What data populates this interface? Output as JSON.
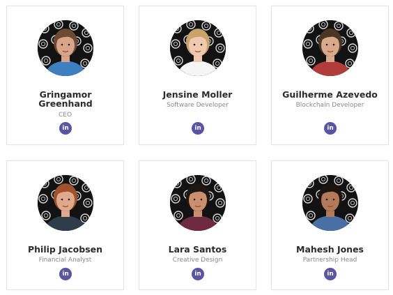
{
  "team": {
    "members": [
      {
        "name": "Gringamor Greenhand",
        "role": "CEO",
        "social_glyph": "in",
        "social_icon": "linkedin-icon",
        "skin": "#d8a48a",
        "hair": "#6b4a32",
        "shirt": "#3e7fc1"
      },
      {
        "name": "Jensine Moller",
        "role": "Software Developer",
        "social_glyph": "in",
        "social_icon": "linkedin-icon",
        "skin": "#f0c9b0",
        "hair": "#c9a36a",
        "shirt": "#f5f5f5"
      },
      {
        "name": "Guilherme Azevedo",
        "role": "Blockchain Developer",
        "social_glyph": "in",
        "social_icon": "linkedin-icon",
        "skin": "#d9a98c",
        "hair": "#4a3624",
        "shirt": "#b23b3b"
      },
      {
        "name": "Philip Jacobsen",
        "role": "Financial Analyst",
        "social_glyph": "in",
        "social_icon": "linkedin-icon",
        "skin": "#e0a98e",
        "hair": "#a0522d",
        "shirt": "#2f3d4a"
      },
      {
        "name": "Lara Santos",
        "role": "Creative Design",
        "social_glyph": "in",
        "social_icon": "linkedin-icon",
        "skin": "#c98f6f",
        "hair": "#1e1612",
        "shirt": "#6e2a40"
      },
      {
        "name": "Mahesh Jones",
        "role": "Partnership Head",
        "social_glyph": "in",
        "social_icon": "linkedin-icon",
        "skin": "#b37a5a",
        "hair": "#1c1410",
        "shirt": "#4a6fa5"
      }
    ]
  },
  "colors": {
    "linkedin_bg": "#5a55a3",
    "name_text": "#2b2b2b",
    "role_text": "#8a8a8a",
    "card_border": "#e4e4e4"
  }
}
